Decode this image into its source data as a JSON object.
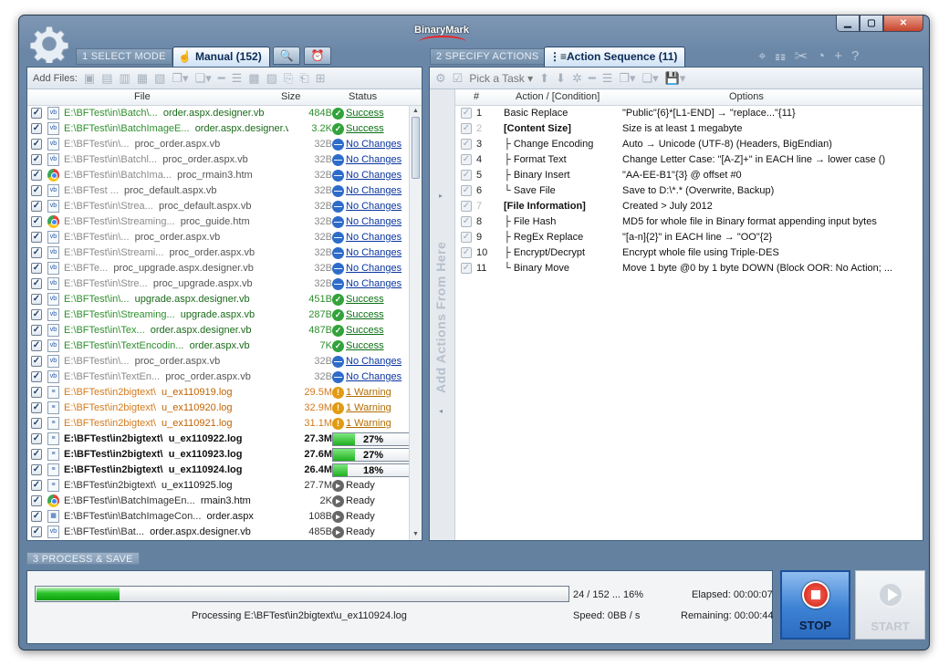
{
  "app": {
    "brand": "BinaryMark"
  },
  "modes": {
    "mode1": "1 SELECT MODE",
    "manual_tab": "Manual (152)",
    "mode2": "2 SPECIFY ACTIONS",
    "action_tab": "Action Sequence (11)",
    "mode3": "3 PROCESS & SAVE"
  },
  "files_toolbar": {
    "add_files": "Add Files:"
  },
  "files_columns": {
    "file": "File",
    "size": "Size",
    "status": "Status"
  },
  "files": [
    {
      "dir": "E:\\BFTest\\in\\Batch\\...",
      "base": "order.aspx.designer.vb",
      "size": "484B",
      "status": "Success",
      "kind": "success",
      "color": "green",
      "icon": "vb"
    },
    {
      "dir": "E:\\BFTest\\in\\BatchImageE...",
      "base": "order.aspx.designer.vb",
      "size": "3.2K",
      "status": "Success",
      "kind": "success",
      "color": "green",
      "icon": "vb"
    },
    {
      "dir": "E:\\BFTest\\in\\...",
      "base": "proc_order.aspx.vb",
      "size": "32B",
      "status": "No Changes",
      "kind": "nochange",
      "color": "gray",
      "icon": "vb"
    },
    {
      "dir": "E:\\BFTest\\in\\Batchl...",
      "base": "proc_order.aspx.vb",
      "size": "32B",
      "status": "No Changes",
      "kind": "nochange",
      "color": "gray",
      "icon": "vb"
    },
    {
      "dir": "E:\\BFTest\\in\\BatchIma...",
      "base": "proc_rmain3.htm",
      "size": "32B",
      "status": "No Changes",
      "kind": "nochange",
      "color": "gray",
      "icon": "chrome"
    },
    {
      "dir": "E:\\BFTest ...",
      "base": "proc_default.aspx.vb",
      "size": "32B",
      "status": "No Changes",
      "kind": "nochange",
      "color": "gray",
      "icon": "vb"
    },
    {
      "dir": "E:\\BFTest\\in\\Strea...",
      "base": "proc_default.aspx.vb",
      "size": "32B",
      "status": "No Changes",
      "kind": "nochange",
      "color": "gray",
      "icon": "vb"
    },
    {
      "dir": "E:\\BFTest\\in\\Streaming...",
      "base": "proc_guide.htm",
      "size": "32B",
      "status": "No Changes",
      "kind": "nochange",
      "color": "gray",
      "icon": "chrome"
    },
    {
      "dir": "E:\\BFTest\\in\\...",
      "base": "proc_order.aspx.vb",
      "size": "32B",
      "status": "No Changes",
      "kind": "nochange",
      "color": "gray",
      "icon": "vb"
    },
    {
      "dir": "E:\\BFTest\\in\\Streami...",
      "base": "proc_order.aspx.vb",
      "size": "32B",
      "status": "No Changes",
      "kind": "nochange",
      "color": "gray",
      "icon": "vb"
    },
    {
      "dir": "E:\\BFTe...",
      "base": "proc_upgrade.aspx.designer.vb",
      "size": "32B",
      "status": "No Changes",
      "kind": "nochange",
      "color": "gray",
      "icon": "vb"
    },
    {
      "dir": "E:\\BFTest\\in\\Stre...",
      "base": "proc_upgrade.aspx.vb",
      "size": "32B",
      "status": "No Changes",
      "kind": "nochange",
      "color": "gray",
      "icon": "vb"
    },
    {
      "dir": "E:\\BFTest\\in\\...",
      "base": "upgrade.aspx.designer.vb",
      "size": "451B",
      "status": "Success",
      "kind": "success",
      "color": "green",
      "icon": "vb"
    },
    {
      "dir": "E:\\BFTest\\in\\Streaming...",
      "base": "upgrade.aspx.vb",
      "size": "287B",
      "status": "Success",
      "kind": "success",
      "color": "green",
      "icon": "vb"
    },
    {
      "dir": "E:\\BFTest\\in\\Tex...",
      "base": "order.aspx.designer.vb",
      "size": "487B",
      "status": "Success",
      "kind": "success",
      "color": "green",
      "icon": "vb"
    },
    {
      "dir": "E:\\BFTest\\in\\TextEncodin...",
      "base": "order.aspx.vb",
      "size": "7K",
      "status": "Success",
      "kind": "success",
      "color": "green",
      "icon": "vb"
    },
    {
      "dir": "E:\\BFTest\\in\\...",
      "base": "proc_order.aspx.vb",
      "size": "32B",
      "status": "No Changes",
      "kind": "nochange",
      "color": "gray",
      "icon": "vb"
    },
    {
      "dir": "E:\\BFTest\\in\\TextEn...",
      "base": "proc_order.aspx.vb",
      "size": "32B",
      "status": "No Changes",
      "kind": "nochange",
      "color": "gray",
      "icon": "vb"
    },
    {
      "dir": "E:\\BFTest\\in2bigtext\\",
      "base": "u_ex110919.log",
      "size": "29.5M",
      "status": "1 Warning",
      "kind": "warning",
      "color": "orange",
      "icon": "log"
    },
    {
      "dir": "E:\\BFTest\\in2bigtext\\",
      "base": "u_ex110920.log",
      "size": "32.9M",
      "status": "1 Warning",
      "kind": "warning",
      "color": "orange",
      "icon": "log"
    },
    {
      "dir": "E:\\BFTest\\in2bigtext\\",
      "base": "u_ex110921.log",
      "size": "31.1M",
      "status": "1 Warning",
      "kind": "warning",
      "color": "orange",
      "icon": "log"
    },
    {
      "dir": "E:\\BFTest\\in2bigtext\\",
      "base": "u_ex110922.log",
      "size": "27.3M",
      "status": "27%",
      "kind": "progress",
      "progress": 0.27,
      "color": "bold",
      "icon": "log"
    },
    {
      "dir": "E:\\BFTest\\in2bigtext\\",
      "base": "u_ex110923.log",
      "size": "27.6M",
      "status": "27%",
      "kind": "progress",
      "progress": 0.27,
      "color": "bold",
      "icon": "log"
    },
    {
      "dir": "E:\\BFTest\\in2bigtext\\",
      "base": "u_ex110924.log",
      "size": "26.4M",
      "status": "18%",
      "kind": "progress",
      "progress": 0.18,
      "color": "bold",
      "icon": "log"
    },
    {
      "dir": "E:\\BFTest\\in2bigtext\\",
      "base": "u_ex110925.log",
      "size": "27.7M",
      "status": "Ready",
      "kind": "ready",
      "color": "black",
      "icon": "log"
    },
    {
      "dir": "E:\\BFTest\\in\\BatchImageEn...",
      "base": "rmain3.htm",
      "size": "2K",
      "status": "Ready",
      "kind": "ready",
      "color": "black",
      "icon": "chrome"
    },
    {
      "dir": "E:\\BFTest\\in\\BatchImageCon...",
      "base": "order.aspx",
      "size": "108B",
      "status": "Ready",
      "kind": "ready",
      "color": "black",
      "icon": "aspx"
    },
    {
      "dir": "E:\\BFTest\\in\\Bat...",
      "base": "order.aspx.designer.vb",
      "size": "485B",
      "status": "Ready",
      "kind": "ready",
      "color": "black",
      "icon": "vb"
    }
  ],
  "actions_toolbar": {
    "pick_task": "Pick a Task"
  },
  "actions_columns": {
    "num": "#",
    "action": "Action / [Condition]",
    "options": "Options"
  },
  "drop_hint": "Add Actions From Here",
  "actions": [
    {
      "num": "1",
      "action": "Basic Replace",
      "options": "\"Public\"{6}*[L1-END] → \"replace...\"{11}",
      "hdr": false
    },
    {
      "num": "2",
      "action": "[Content Size]",
      "options": "Size is at least 1 megabyte",
      "hdr": true,
      "dim": true
    },
    {
      "num": "3",
      "action": "├ Change Encoding",
      "options": "Auto → Unicode (UTF-8) (Headers, BigEndian)",
      "hdr": false
    },
    {
      "num": "4",
      "action": "├ Format Text",
      "options": "Change Letter Case: \"[A-Z]+\" in EACH line → lower case ()",
      "hdr": false
    },
    {
      "num": "5",
      "action": "├ Binary Insert",
      "options": "\"AA-EE-B1\"{3} @ offset #0",
      "hdr": false
    },
    {
      "num": "6",
      "action": "└ Save File",
      "options": "Save to D:\\*.* (Overwrite, Backup)",
      "hdr": false
    },
    {
      "num": "7",
      "action": "[File Information]",
      "options": "Created > July 2012",
      "hdr": true,
      "dim": true
    },
    {
      "num": "8",
      "action": "├ File Hash",
      "options": "MD5 for whole file in Binary format appending input bytes",
      "hdr": false
    },
    {
      "num": "9",
      "action": "├ RegEx Replace",
      "options": "\"[a-n]{2}\" in EACH line → \"OO\"{2}",
      "hdr": false
    },
    {
      "num": "10",
      "action": "├ Encrypt/Decrypt",
      "options": "Encrypt whole file using Triple-DES",
      "hdr": false
    },
    {
      "num": "11",
      "action": "└ Binary Move",
      "options": "Move 1 byte @0 by 1 byte DOWN (Block OOR: No Action; ...",
      "hdr": false
    }
  ],
  "process": {
    "count": "24 / 152 ... 16%",
    "progress": 0.16,
    "elapsed": "Elapsed: 00:00:07",
    "speed": "Speed: 0BB / s",
    "remaining": "Remaining: 00:00:44",
    "processing": "Processing E:\\BFTest\\in2bigtext\\u_ex110924.log"
  },
  "buttons": {
    "stop": "STOP",
    "start": "START"
  },
  "colors": {
    "accent": "#2c6cc0",
    "success": "#32a33a",
    "warning": "#e39b12",
    "nochange": "#2e6cc9"
  }
}
